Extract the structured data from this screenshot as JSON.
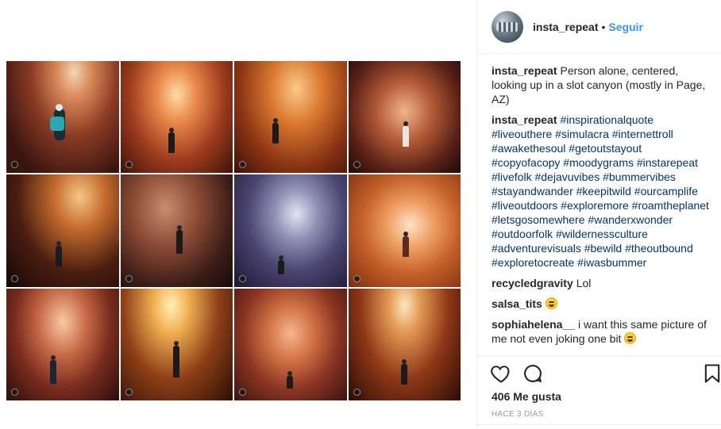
{
  "post": {
    "username": "insta_repeat",
    "separator": "•",
    "follow_label": "Seguir",
    "likes_text": "406 Me gusta",
    "timestamp": "HACE 3 DÍAS"
  },
  "comments": [
    {
      "author": "insta_repeat",
      "text": "Person alone, centered, looking up in a slot canyon (mostly in Page, AZ)"
    },
    {
      "author": "insta_repeat",
      "hashtags": "#inspirationalquote #liveouthere #simulacra #internettroll #awakethesoul #getoutstayout #copyofacopy #moodygrams #instarepeat #livefolk #dejavuvibes #bummervibes #stayandwander #keepitwild #ourcamplife #liveoutdoors #exploremore #roamtheplanet #letsgosomewhere #wanderxwonder #outdoorfolk #wildernessculture #adventurevisuals #bewild #theoutbound #exploretocreate #iwasbummer"
    },
    {
      "author": "recycledgravity",
      "text": "Lol"
    },
    {
      "author": "salsa_tits",
      "text": "",
      "emoji": "grinning-sweat-emoji"
    },
    {
      "author": "sophiahelena__",
      "text": "i want this same picture of me not even joking one bit",
      "emoji": "grinning-sweat-emoji"
    }
  ],
  "icons": {
    "like": "heart-icon",
    "comment": "comment-bubble-icon",
    "save": "bookmark-icon",
    "badge": "user-tag-badge"
  },
  "colors": {
    "link": "#3897f0",
    "hashtag": "#003569",
    "text": "#262626",
    "muted": "#999999"
  }
}
